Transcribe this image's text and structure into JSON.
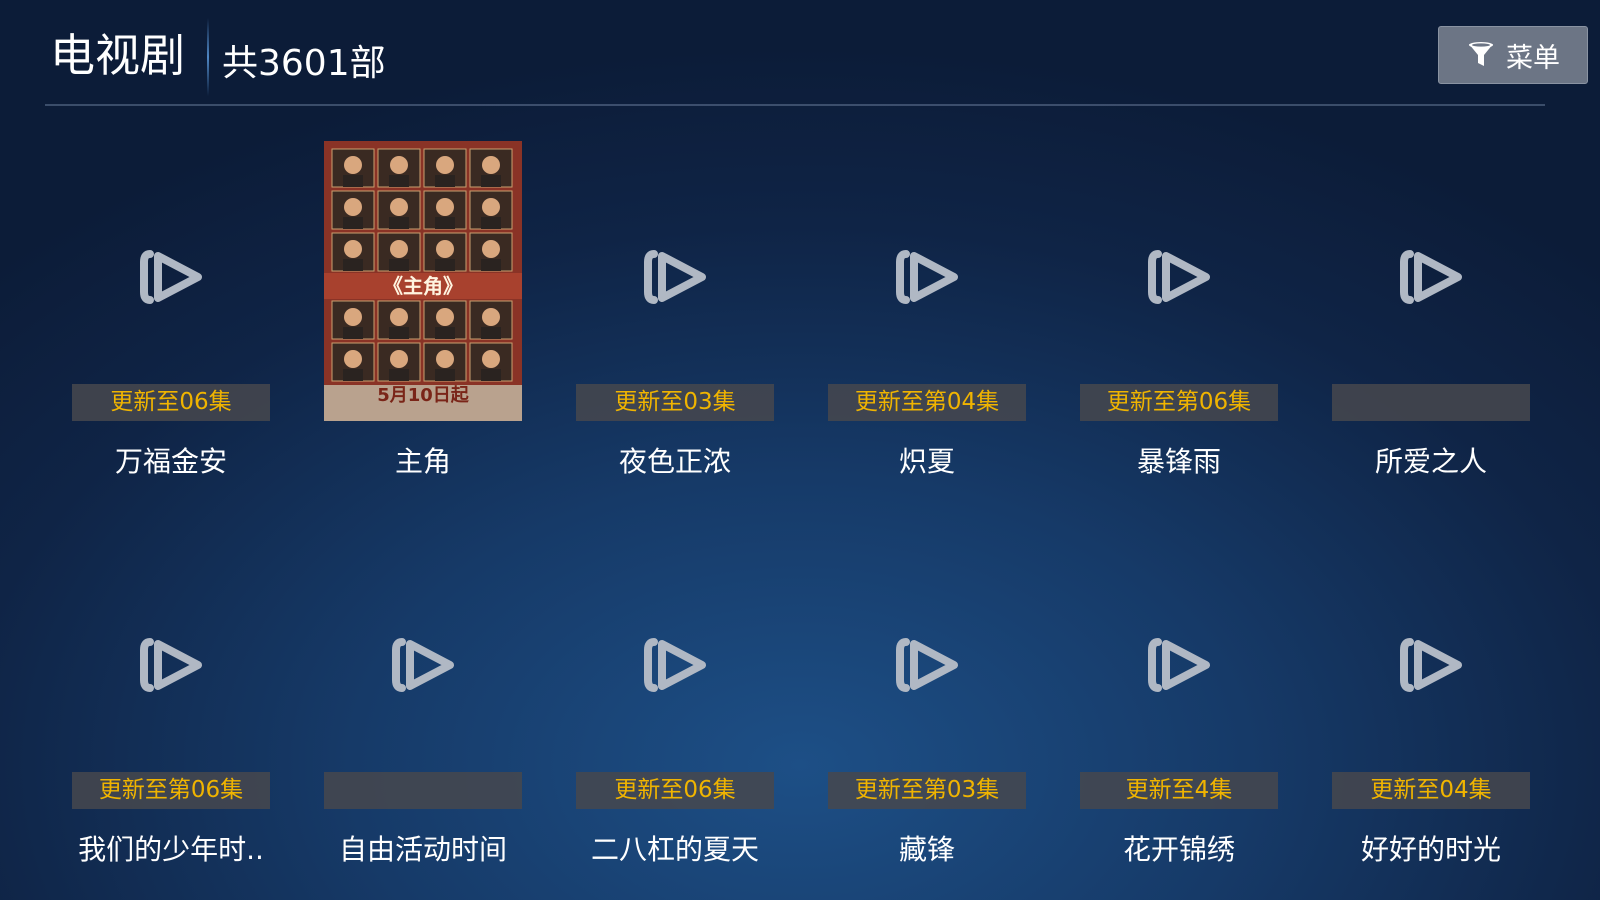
{
  "header": {
    "title": "电视剧",
    "count": "共3601部",
    "menu_label": "菜单"
  },
  "poster_text": {
    "title": "《主角》",
    "date": "5月10日起"
  },
  "row1": [
    {
      "title": "万福金安",
      "badge": "更新至06集",
      "has_poster": false
    },
    {
      "title": "主角",
      "badge": "",
      "has_poster": true
    },
    {
      "title": "夜色正浓",
      "badge": "更新至03集",
      "has_poster": false
    },
    {
      "title": "炽夏",
      "badge": "更新至第04集",
      "has_poster": false
    },
    {
      "title": "暴锋雨",
      "badge": "更新至第06集",
      "has_poster": false
    },
    {
      "title": "所爱之人",
      "badge": "",
      "has_poster": false
    }
  ],
  "row2": [
    {
      "title": "我们的少年时..",
      "badge": "更新至第06集",
      "has_poster": false
    },
    {
      "title": "自由活动时间",
      "badge": "",
      "has_poster": false
    },
    {
      "title": "二八杠的夏天",
      "badge": "更新至06集",
      "has_poster": false
    },
    {
      "title": "藏锋",
      "badge": "更新至第03集",
      "has_poster": false
    },
    {
      "title": "花开锦绣",
      "badge": "更新至4集",
      "has_poster": false
    },
    {
      "title": "好好的时光",
      "badge": "更新至04集",
      "has_poster": false
    }
  ],
  "colors": {
    "badge_text": "#f0b400",
    "background": "#163a68"
  },
  "icons": {
    "placeholder": "play-placeholder-icon",
    "menu": "filter-icon"
  }
}
